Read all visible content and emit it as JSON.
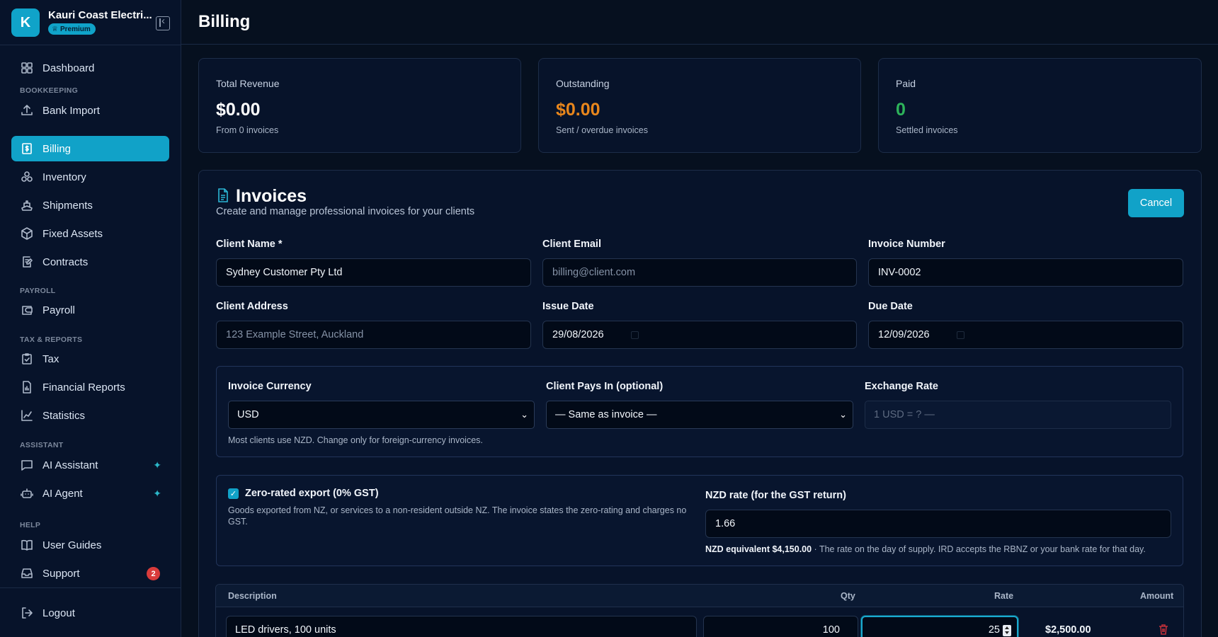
{
  "brand": {
    "initial": "K",
    "name": "Kauri Coast Electri...",
    "badge": "Premium"
  },
  "sidebar": {
    "items": [
      {
        "label": "Dashboard"
      },
      {
        "label": "Bank Import"
      },
      {
        "label": "Billing"
      },
      {
        "label": "Inventory"
      },
      {
        "label": "Shipments"
      },
      {
        "label": "Fixed Assets"
      },
      {
        "label": "Contracts"
      },
      {
        "label": "Payroll"
      },
      {
        "label": "Tax"
      },
      {
        "label": "Financial Reports"
      },
      {
        "label": "Statistics"
      },
      {
        "label": "AI Assistant"
      },
      {
        "label": "AI Agent"
      },
      {
        "label": "User Guides"
      },
      {
        "label": "Support",
        "badge": "2"
      },
      {
        "label": "Logout"
      }
    ],
    "sections": {
      "bookkeeping": "BOOKKEEPING",
      "payroll": "PAYROLL",
      "tax_reports": "TAX & REPORTS",
      "assistant": "ASSISTANT",
      "help": "HELP"
    },
    "active": "Billing"
  },
  "header": {
    "title": "Billing"
  },
  "stats": [
    {
      "label": "Total Revenue",
      "value": "$0.00",
      "sub": "From 0 invoices",
      "color": "#ffffff"
    },
    {
      "label": "Outstanding",
      "value": "$0.00",
      "sub": "Sent / overdue invoices",
      "color": "#e8861c"
    },
    {
      "label": "Paid",
      "value": "0",
      "sub": "Settled invoices",
      "color": "#2db35a"
    }
  ],
  "invoices": {
    "title": "Invoices",
    "subtitle": "Create and manage professional invoices for your clients",
    "cancel_label": "Cancel",
    "fields": {
      "client_name": {
        "label": "Client Name *",
        "value": "Sydney Customer Pty Ltd"
      },
      "client_email": {
        "label": "Client Email",
        "placeholder": "billing@client.com"
      },
      "invoice_number": {
        "label": "Invoice Number",
        "value": "INV-0002"
      },
      "client_address": {
        "label": "Client Address",
        "placeholder": "123 Example Street, Auckland"
      },
      "issue_date": {
        "label": "Issue Date",
        "value": "29/08/2026"
      },
      "due_date": {
        "label": "Due Date",
        "value": "12/09/2026"
      }
    },
    "currency": {
      "invoice_currency_label": "Invoice Currency",
      "invoice_currency_value": "USD",
      "client_pays_label": "Client Pays In (optional)",
      "client_pays_value": "— Same as invoice —",
      "exchange_rate_label": "Exchange Rate",
      "exchange_rate_placeholder": "1 USD = ? —",
      "hint": "Most clients use NZD. Change only for foreign-currency invoices."
    },
    "zero_rated": {
      "checked": true,
      "title": "Zero-rated export (0% GST)",
      "description": "Goods exported from NZ, or services to a non-resident outside NZ. The invoice states the zero-rating and charges no GST.",
      "nzd_rate_label": "NZD rate (for the GST return)",
      "nzd_rate_value": "1.66",
      "nzd_equivalent": "NZD equivalent $4,150.00",
      "nzd_note": " · The rate on the day of supply. IRD accepts the RBNZ or your bank rate for that day."
    },
    "line_items": {
      "columns": [
        "Description",
        "Qty",
        "Rate",
        "Amount"
      ],
      "rows": [
        {
          "description": "LED drivers, 100 units",
          "qty": "100",
          "rate": "25",
          "amount": "$2,500.00"
        }
      ]
    }
  }
}
